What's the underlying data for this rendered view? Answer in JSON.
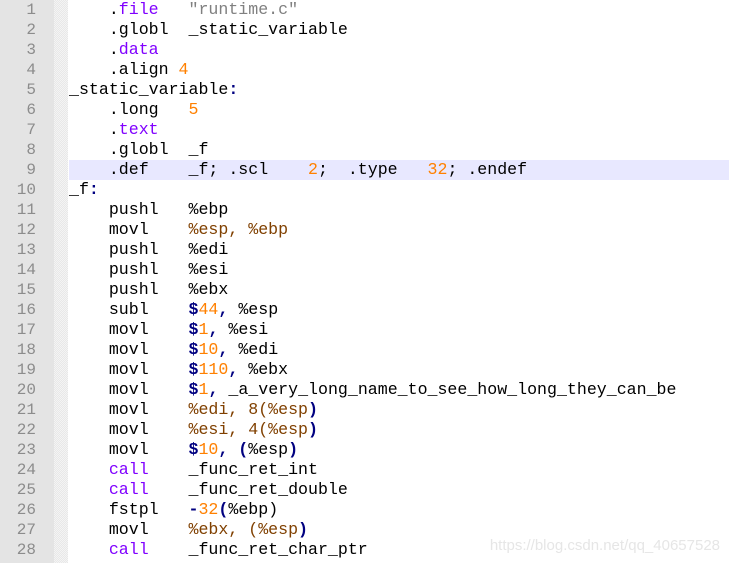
{
  "editor": {
    "current_line": 9,
    "colors": {
      "gutter_bg": "#e4e4e4",
      "line_number": "#8c8c8c",
      "current_line_bg": "#e8e8ff",
      "directive": "#8000ff",
      "string": "#808080",
      "number": "#ff8000",
      "register": "#804000",
      "operator": "#000080"
    },
    "lines": [
      {
        "n": "1",
        "tokens": [
          [
            "plain",
            "    ."
          ],
          [
            "dir",
            "file"
          ],
          [
            "plain",
            "   "
          ],
          [
            "str",
            "\"runtime.c\""
          ]
        ]
      },
      {
        "n": "2",
        "tokens": [
          [
            "plain",
            "    .globl  _static_variable"
          ]
        ]
      },
      {
        "n": "3",
        "tokens": [
          [
            "plain",
            "    ."
          ],
          [
            "dir",
            "data"
          ]
        ]
      },
      {
        "n": "4",
        "tokens": [
          [
            "plain",
            "    .align "
          ],
          [
            "num",
            "4"
          ]
        ]
      },
      {
        "n": "5",
        "tokens": [
          [
            "plain",
            "_static_variable"
          ],
          [
            "op",
            ":"
          ]
        ]
      },
      {
        "n": "6",
        "tokens": [
          [
            "plain",
            "    .long   "
          ],
          [
            "num",
            "5"
          ]
        ]
      },
      {
        "n": "7",
        "tokens": [
          [
            "plain",
            "    ."
          ],
          [
            "dir",
            "text"
          ]
        ]
      },
      {
        "n": "8",
        "tokens": [
          [
            "plain",
            "    .globl  _f"
          ]
        ]
      },
      {
        "n": "9",
        "tokens": [
          [
            "plain",
            "    .def    _f; .scl    "
          ],
          [
            "num",
            "2"
          ],
          [
            "plain",
            ";  .type   "
          ],
          [
            "num",
            "32"
          ],
          [
            "plain",
            "; .endef"
          ]
        ]
      },
      {
        "n": "10",
        "tokens": [
          [
            "plain",
            "_f"
          ],
          [
            "op",
            ":"
          ]
        ]
      },
      {
        "n": "11",
        "tokens": [
          [
            "plain",
            "    pushl   %ebp"
          ]
        ]
      },
      {
        "n": "12",
        "tokens": [
          [
            "plain",
            "    movl    "
          ],
          [
            "reg",
            "%esp, %ebp"
          ]
        ]
      },
      {
        "n": "13",
        "tokens": [
          [
            "plain",
            "    pushl   %edi"
          ]
        ]
      },
      {
        "n": "14",
        "tokens": [
          [
            "plain",
            "    pushl   %esi"
          ]
        ]
      },
      {
        "n": "15",
        "tokens": [
          [
            "plain",
            "    pushl   %ebx"
          ]
        ]
      },
      {
        "n": "16",
        "tokens": [
          [
            "plain",
            "    subl    "
          ],
          [
            "op",
            "$"
          ],
          [
            "num",
            "44"
          ],
          [
            "op",
            ","
          ],
          [
            "plain",
            " %esp"
          ]
        ]
      },
      {
        "n": "17",
        "tokens": [
          [
            "plain",
            "    movl    "
          ],
          [
            "op",
            "$"
          ],
          [
            "num",
            "1"
          ],
          [
            "op",
            ","
          ],
          [
            "plain",
            " %esi"
          ]
        ]
      },
      {
        "n": "18",
        "tokens": [
          [
            "plain",
            "    movl    "
          ],
          [
            "op",
            "$"
          ],
          [
            "num",
            "10"
          ],
          [
            "op",
            ","
          ],
          [
            "plain",
            " %edi"
          ]
        ]
      },
      {
        "n": "19",
        "tokens": [
          [
            "plain",
            "    movl    "
          ],
          [
            "op",
            "$"
          ],
          [
            "num",
            "110"
          ],
          [
            "op",
            ","
          ],
          [
            "plain",
            " %ebx"
          ]
        ]
      },
      {
        "n": "20",
        "tokens": [
          [
            "plain",
            "    movl    "
          ],
          [
            "op",
            "$"
          ],
          [
            "num",
            "1"
          ],
          [
            "op",
            ","
          ],
          [
            "plain",
            " _a_very_long_name_to_see_how_long_they_can_be"
          ]
        ]
      },
      {
        "n": "21",
        "tokens": [
          [
            "plain",
            "    movl    "
          ],
          [
            "reg",
            "%edi, 8(%esp"
          ],
          [
            "op",
            ")"
          ]
        ]
      },
      {
        "n": "22",
        "tokens": [
          [
            "plain",
            "    movl    "
          ],
          [
            "reg",
            "%esi, 4(%esp"
          ],
          [
            "op",
            ")"
          ]
        ]
      },
      {
        "n": "23",
        "tokens": [
          [
            "plain",
            "    movl    "
          ],
          [
            "op",
            "$"
          ],
          [
            "num",
            "10"
          ],
          [
            "op",
            ", ("
          ],
          [
            "plain",
            "%esp"
          ],
          [
            "op",
            ")"
          ]
        ]
      },
      {
        "n": "24",
        "tokens": [
          [
            "plain",
            "    "
          ],
          [
            "kw",
            "call"
          ],
          [
            "plain",
            "    _func_ret_int"
          ]
        ]
      },
      {
        "n": "25",
        "tokens": [
          [
            "plain",
            "    "
          ],
          [
            "kw",
            "call"
          ],
          [
            "plain",
            "    _func_ret_double"
          ]
        ]
      },
      {
        "n": "26",
        "tokens": [
          [
            "plain",
            "    fstpl   "
          ],
          [
            "op",
            "-"
          ],
          [
            "num",
            "32"
          ],
          [
            "op",
            "("
          ],
          [
            "plain",
            "%ebp)"
          ]
        ]
      },
      {
        "n": "27",
        "tokens": [
          [
            "plain",
            "    movl    "
          ],
          [
            "reg",
            "%ebx, (%esp"
          ],
          [
            "op",
            ")"
          ]
        ]
      },
      {
        "n": "28",
        "tokens": [
          [
            "plain",
            "    "
          ],
          [
            "kw",
            "call"
          ],
          [
            "plain",
            "    _func_ret_char_ptr"
          ]
        ]
      }
    ]
  },
  "watermark": "https://blog.csdn.net/qq_40657528"
}
